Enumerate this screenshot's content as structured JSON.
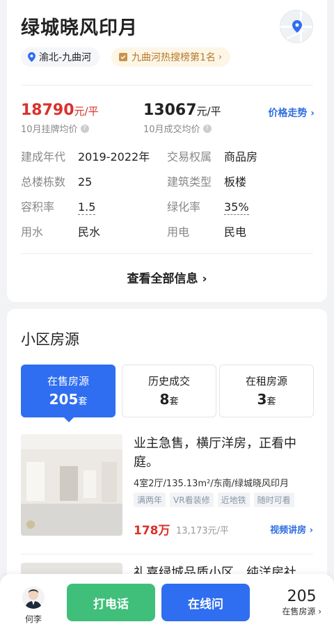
{
  "community": {
    "name": "绿城晓风印月",
    "location_tag": "渝北-九曲河",
    "rank_tag": "九曲河热搜榜第1名"
  },
  "prices": {
    "listing_value": "18790",
    "listing_unit": "元/平",
    "listing_label": "10月挂牌均价",
    "deal_value": "13067",
    "deal_unit": "元/平",
    "deal_label": "10月成交均价",
    "trend_link": "价格走势"
  },
  "info": [
    {
      "key": "建成年代",
      "value": "2019-2022年"
    },
    {
      "key": "交易权属",
      "value": "商品房"
    },
    {
      "key": "总楼栋数",
      "value": "25"
    },
    {
      "key": "建筑类型",
      "value": "板楼"
    },
    {
      "key": "容积率",
      "value": "1.5"
    },
    {
      "key": "绿化率",
      "value": "35%"
    },
    {
      "key": "用水",
      "value": "民水"
    },
    {
      "key": "用电",
      "value": "民电"
    }
  ],
  "all_info_link": "查看全部信息",
  "listings_section": {
    "title": "小区房源",
    "tabs": [
      {
        "label": "在售房源",
        "count": "205",
        "unit": "套"
      },
      {
        "label": "历史成交",
        "count": "8",
        "unit": "套"
      },
      {
        "label": "在租房源",
        "count": "3",
        "unit": "套"
      }
    ],
    "listing1": {
      "title": "业主急售，横厅洋房，正看中庭。",
      "desc": "4室2厅/135.13m²/东南/绿城晓风印月",
      "tags": [
        "满两年",
        "VR看装修",
        "近地铁",
        "随时可看"
      ],
      "price": "178万",
      "unit_price": "13,173元/平",
      "video_link": "视频讲房"
    },
    "listing2": {
      "title": "礼嘉绿城品质小区，纯洋房社"
    }
  },
  "bottom_bar": {
    "agent_name": "何李",
    "call_label": "打电话",
    "chat_label": "在线问",
    "count": "205",
    "count_label": "在售房源"
  },
  "colors": {
    "accent_blue": "#2f6ef0",
    "price_red": "#d9312b",
    "call_green": "#3fbf7a"
  }
}
